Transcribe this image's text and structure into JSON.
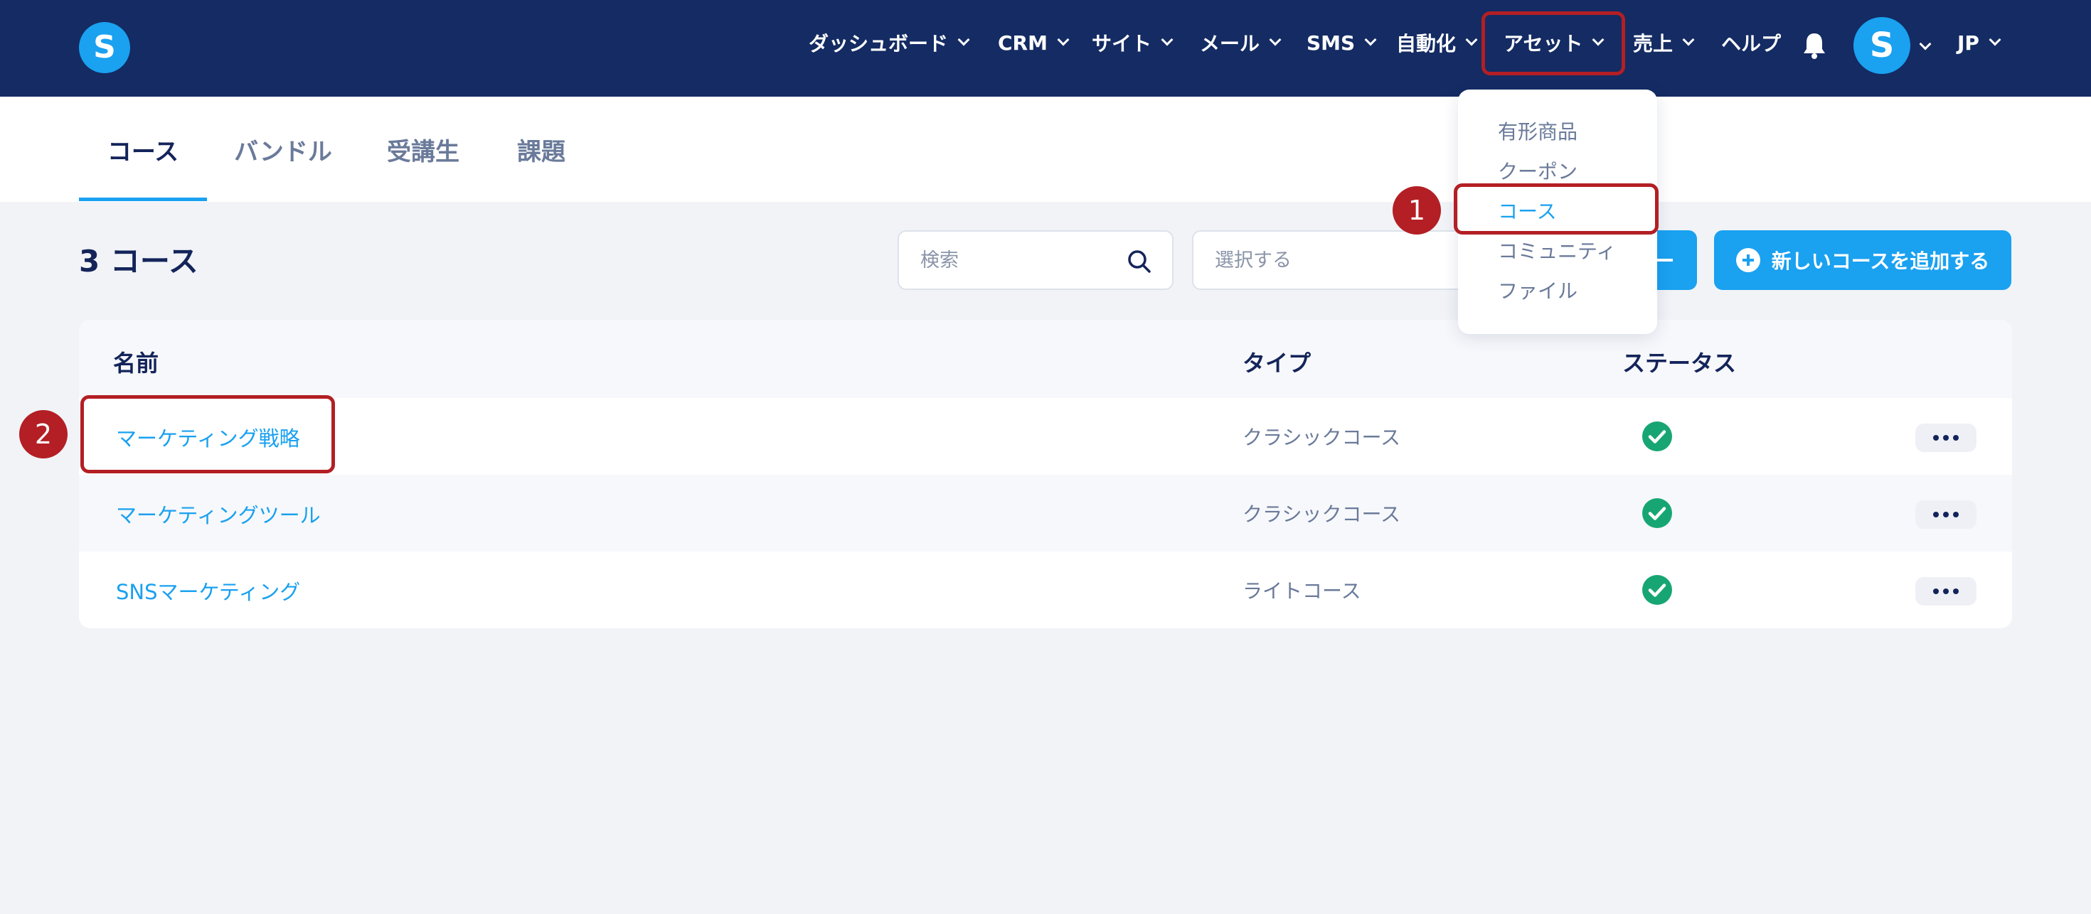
{
  "brand": {
    "logo_letter": "S",
    "accent": "#1aa1f0",
    "nav_bg": "#142b63",
    "highlight": "#b31f24"
  },
  "nav": {
    "items": [
      {
        "label": "ダッシュボード"
      },
      {
        "label": "CRM"
      },
      {
        "label": "サイト"
      },
      {
        "label": "メール"
      },
      {
        "label": "SMS"
      },
      {
        "label": "自動化"
      },
      {
        "label": "アセット"
      },
      {
        "label": "売上"
      },
      {
        "label": "ヘルプ"
      }
    ],
    "bell_icon": "bell-icon",
    "avatar_letter": "S",
    "language": "JP"
  },
  "assets_menu": {
    "items": [
      {
        "label": "有形商品"
      },
      {
        "label": "クーポン"
      },
      {
        "label": "コース"
      },
      {
        "label": "コミュニティ"
      },
      {
        "label": "ファイル"
      }
    ],
    "active": "コース"
  },
  "tabs": [
    {
      "label": "コース"
    },
    {
      "label": "バンドル"
    },
    {
      "label": "受講生"
    },
    {
      "label": "課題"
    }
  ],
  "page": {
    "title": "3 コース",
    "search_placeholder": "検索",
    "select_placeholder": "選択する",
    "add_button": "新しいコースを追加する"
  },
  "table": {
    "headers": {
      "name": "名前",
      "type": "タイプ",
      "status": "ステータス"
    },
    "rows": [
      {
        "name": "マーケティング戦略",
        "type": "クラシックコース",
        "status": "active"
      },
      {
        "name": "マーケティングツール",
        "type": "クラシックコース",
        "status": "active"
      },
      {
        "name": "SNSマーケティング",
        "type": "ライトコース",
        "status": "active"
      }
    ]
  },
  "annotations": {
    "marker_1": "1",
    "marker_2": "2"
  }
}
